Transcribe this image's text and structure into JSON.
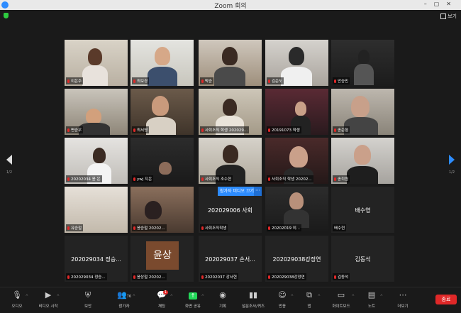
{
  "window": {
    "title": "Zoom 회의"
  },
  "top_right": {
    "view_label": "보기"
  },
  "nav": {
    "left_page": "1/2",
    "right_page": "1/2"
  },
  "hover": {
    "label": "참가자 비디오 끄기"
  },
  "tiles": [
    {
      "name": "이은주"
    },
    {
      "name": "최보경"
    },
    {
      "name": "박승"
    },
    {
      "name": "김준도"
    },
    {
      "name": "안승민"
    },
    {
      "name": "변승우"
    },
    {
      "name": "최서영"
    },
    {
      "name": "사회조직 학생 202029..."
    },
    {
      "name": "20191073 학생"
    },
    {
      "name": "송준형"
    },
    {
      "name": "20202034 윤 은"
    },
    {
      "name": "ywj 지은"
    },
    {
      "name": "사회조직 조수현"
    },
    {
      "name": "사회조직 학생 20202..."
    },
    {
      "name": "송희원"
    },
    {
      "name": "유승철"
    },
    {
      "name": "윤승철 20202..."
    },
    {
      "name": "사회조직학생"
    },
    {
      "name": "20202019 이..."
    },
    {
      "name": "배수현"
    },
    {
      "name": "202029034 정승..."
    },
    {
      "name": "윤상철 20202..."
    },
    {
      "name": "20202037 강서현"
    },
    {
      "name": "202029038강정연"
    },
    {
      "name": "김동석"
    }
  ],
  "center_names": {
    "t18": "202029006 사회",
    "t20": "배수영",
    "t21": "202029034 정승...",
    "t22": "윤상",
    "t23": "202029037 손서...",
    "t24": "202029038강정연",
    "t25": "김동석"
  },
  "toolbar": {
    "audio": "오디오",
    "video": "비디오 시작",
    "security": "보안",
    "participants": "참가자",
    "participants_count": "76",
    "chat": "채팅",
    "chat_badge": "1",
    "share": "화면 공유",
    "record": "기록",
    "polls": "설문조사/퀴즈",
    "reactions": "반응",
    "apps": "앱",
    "whiteboard": "화이트보드",
    "notes": "노트",
    "more": "더보기",
    "end": "종료"
  }
}
